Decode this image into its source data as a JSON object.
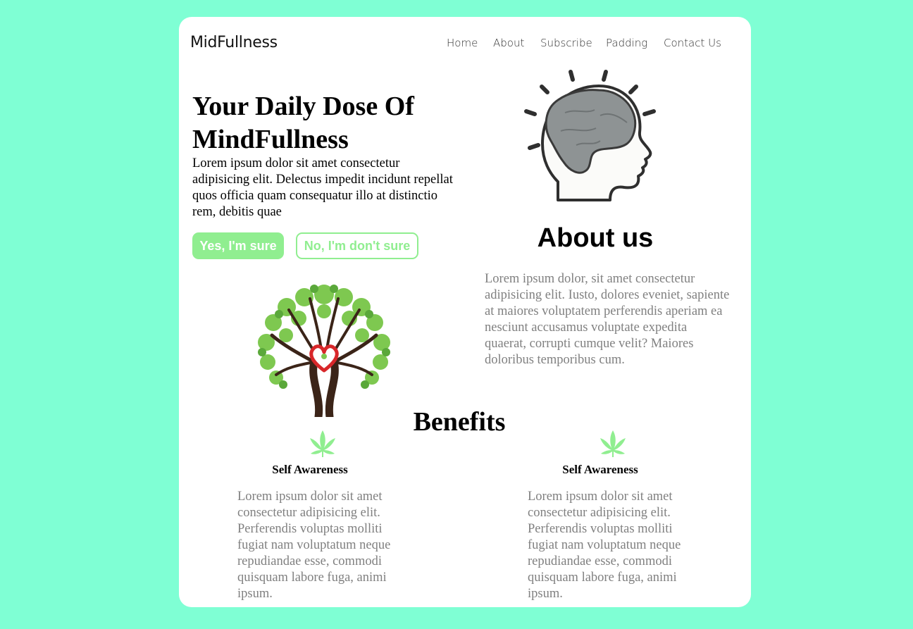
{
  "brand": {
    "logo_text": "MidFullness"
  },
  "nav": {
    "items": [
      {
        "label": "Home"
      },
      {
        "label": "About"
      },
      {
        "label": "Subscribe"
      },
      {
        "label": "Padding"
      },
      {
        "label": "Contact Us"
      }
    ]
  },
  "hero": {
    "title": "Your Daily Dose Of MindFullness",
    "text": "Lorem ipsum dolor sit amet consectetur adipisicing elit. Delectus impedit incidunt repellat quos officia quam consequatur illo at distinctio rem, debitis quae",
    "yes_button": "Yes, I'm sure",
    "no_button": "No, I'm don't sure"
  },
  "about": {
    "title": "About us",
    "text": "Lorem ipsum dolor, sit amet consectetur adipisicing elit. Iusto, dolores eveniet, sapiente at maiores voluptatem perferendis aperiam ea nesciunt accusamus voluptate expedita quaerat, corrupti cumque velit? Maiores doloribus temporibus cum."
  },
  "benefits": {
    "title": "Benefits",
    "items": [
      {
        "icon": "leaf-icon",
        "title": "Self Awareness",
        "text": "Lorem ipsum dolor sit amet consectetur adipisicing elit. Perferendis voluptas molliti fugiat nam voluptatum neque repudiandae esse, commodi quisquam labore fuga, animi ipsum."
      },
      {
        "icon": "leaf-icon",
        "title": "Self Awareness",
        "text": "Lorem ipsum dolor sit amet consectetur adipisicing elit. Perferendis voluptas molliti fugiat nam voluptatum neque repudiandae esse, commodi quisquam labore fuga, animi ipsum."
      }
    ]
  },
  "colors": {
    "page_background": "#7fffd4",
    "card_background": "#ffffff",
    "accent_green": "#90ee90",
    "muted_text": "#808080"
  }
}
